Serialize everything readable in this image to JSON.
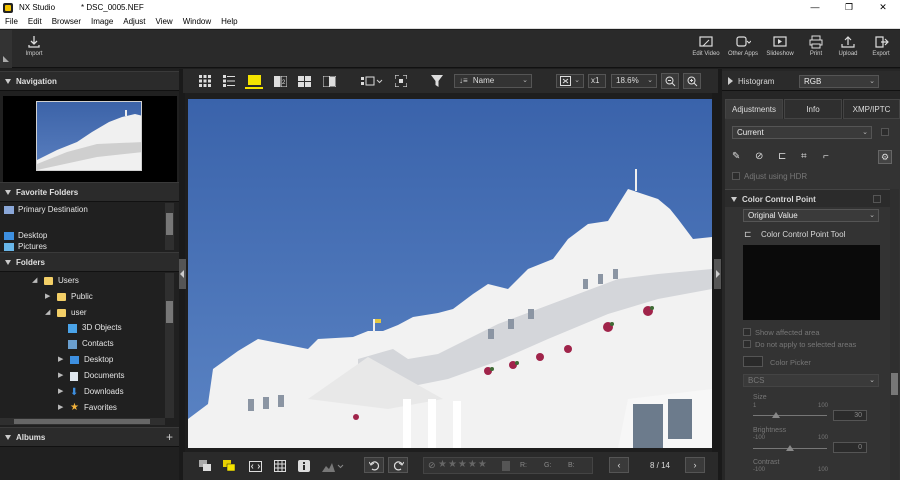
{
  "window": {
    "app_name": "NX Studio",
    "file_name": "* DSC_0005.NEF",
    "controls": [
      "—",
      "❐",
      "✕"
    ]
  },
  "menu": [
    "File",
    "Edit",
    "Browser",
    "Image",
    "Adjust",
    "View",
    "Window",
    "Help"
  ],
  "toolbar": {
    "import_label": "Import",
    "right_buttons": [
      {
        "label": "Edit Video",
        "icon": "edit-video-icon"
      },
      {
        "label": "Other Apps",
        "icon": "other-apps-icon"
      },
      {
        "label": "Slideshow",
        "icon": "slideshow-icon"
      },
      {
        "label": "Print",
        "icon": "print-icon"
      },
      {
        "label": "Upload",
        "icon": "upload-icon"
      },
      {
        "label": "Export",
        "icon": "export-icon"
      }
    ]
  },
  "left_panel": {
    "navigation_title": "Navigation",
    "favorite_folders_title": "Favorite Folders",
    "favorites": [
      "Primary Destination",
      "Desktop",
      "Pictures"
    ],
    "folders_title": "Folders",
    "tree": [
      {
        "label": "Users",
        "level": 0,
        "arrow": "◢",
        "icon": "folder"
      },
      {
        "label": "Public",
        "level": 1,
        "arrow": "▶",
        "icon": "folder"
      },
      {
        "label": "user",
        "level": 1,
        "arrow": "◢",
        "icon": "folder"
      },
      {
        "label": "3D Objects",
        "level": 2,
        "arrow": "",
        "icon": "3d"
      },
      {
        "label": "Contacts",
        "level": 2,
        "arrow": "",
        "icon": "contacts"
      },
      {
        "label": "Desktop",
        "level": 2,
        "arrow": "▶",
        "icon": "desktop"
      },
      {
        "label": "Documents",
        "level": 2,
        "arrow": "▶",
        "icon": "documents"
      },
      {
        "label": "Downloads",
        "level": 2,
        "arrow": "▶",
        "icon": "downloads"
      },
      {
        "label": "Favorites",
        "level": 2,
        "arrow": "▶",
        "icon": "star"
      }
    ],
    "albums_title": "Albums",
    "albums_add": "+"
  },
  "center": {
    "sort_label": "Name",
    "zoom_multiplier": "x1",
    "zoom_value": "18.6%",
    "rgb_labels": [
      "R:",
      "G:",
      "B:"
    ],
    "page_indicator": "8 / 14",
    "rating": 0
  },
  "right_panel": {
    "histogram_title": "Histogram",
    "histogram_channel": "RGB",
    "tabs": [
      "Adjustments",
      "Info",
      "XMP/IPTC"
    ],
    "active_tab": "Adjustments",
    "preset": "Current",
    "hdr_label": "Adjust using HDR",
    "ccp_title": "Color Control Point",
    "ccp_mode": "Original Value",
    "ccp_tool": "Color Control Point Tool",
    "show_affected": "Show affected area",
    "not_apply": "Do not apply to selected areas",
    "color_picker": "Color Picker",
    "color_model": "BCS",
    "size": {
      "label": "Size",
      "min": "1",
      "max": "100",
      "value": "30"
    },
    "brightness": {
      "label": "Brightness",
      "min": "-100",
      "max": "100",
      "value": "0"
    },
    "contrast": {
      "label": "Contrast",
      "min": "-100",
      "max": "100"
    }
  },
  "colors": {
    "sky": "#3a64ae",
    "accent_yellow": "#f5e400",
    "panel_bg": "#262626"
  }
}
